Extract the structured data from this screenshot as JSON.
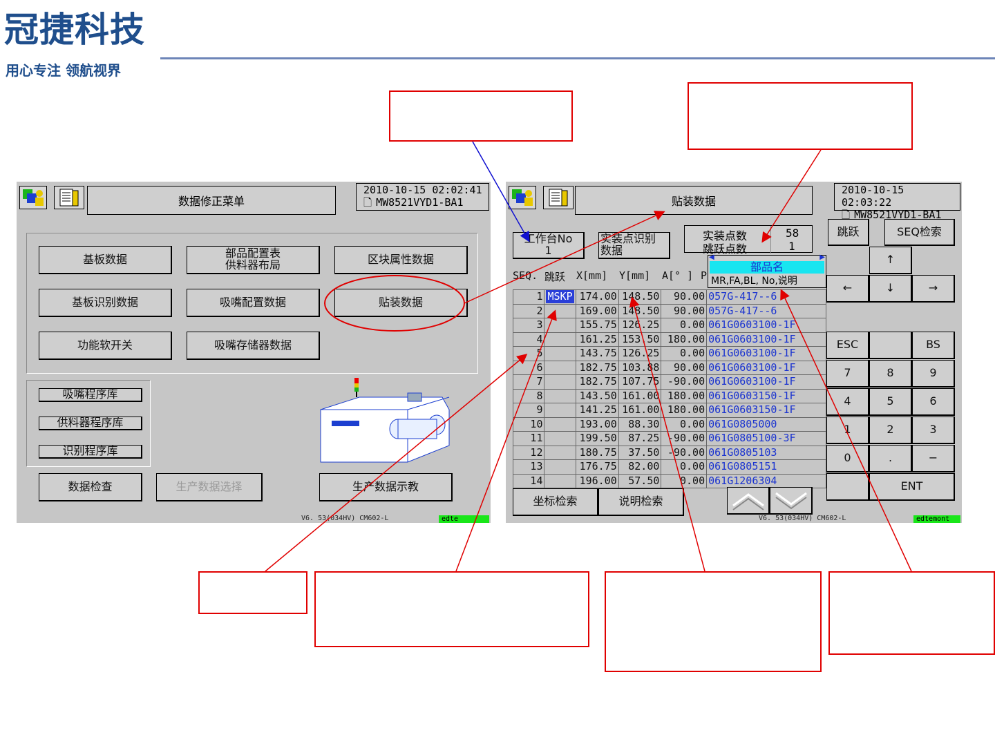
{
  "logo": {
    "main": "冠捷科技",
    "sub": "用心专注 领航视界"
  },
  "left_screen": {
    "title": "数据修正菜单",
    "datetime": "2010-10-15  02:02:41",
    "program": "MW8521VYD1-BA1",
    "menu": [
      {
        "label": "基板数据"
      },
      {
        "label": "部品配置表\n供料器布局"
      },
      {
        "label": "区块属性数据"
      },
      {
        "label": "基板识别数据"
      },
      {
        "label": "吸嘴配置数据"
      },
      {
        "label": "贴装数据"
      },
      {
        "label": "功能软开关"
      },
      {
        "label": "吸嘴存储器数据"
      }
    ],
    "libraries": [
      "吸嘴程序库",
      "供料器程序库",
      "识别程序库"
    ],
    "bottom": {
      "check": "数据检查",
      "select": "生产数据选择",
      "teach": "生产数据示教"
    },
    "version": "V6. 53(034HV)   CM602-L",
    "status": "edte"
  },
  "right_screen": {
    "title": "贴装数据",
    "datetime": "2010-10-15  02:03:22",
    "program": "MW8521VYD1-BA1",
    "table_no_label": "工作台No",
    "table_no_value": "1",
    "recog_label": "实装点识别\n数据",
    "count_mount_label": "实装点数",
    "count_mount_value": "58",
    "count_skip_label": "跳跃点数",
    "count_skip_value": "1",
    "jump_button": "跳跃",
    "seq_search_button": "SEQ检索",
    "columns": [
      "SEQ.",
      "跳跃",
      "X[mm]",
      "Y[mm]",
      "A[° ]",
      "P"
    ],
    "part_header": "部品名",
    "part_subheader": "MR,FA,BL,   No,说明",
    "rows": [
      {
        "seq": "1",
        "skip": "MSKP",
        "x": "174.00",
        "y": "148.50",
        "a": "90.00",
        "part": "057G-417--6"
      },
      {
        "seq": "2",
        "skip": "",
        "x": "169.00",
        "y": "148.50",
        "a": "90.00",
        "part": "057G-417--6"
      },
      {
        "seq": "3",
        "skip": "",
        "x": "155.75",
        "y": "126.25",
        "a": "0.00",
        "part": "061G0603100-1F"
      },
      {
        "seq": "4",
        "skip": "",
        "x": "161.25",
        "y": "153.50",
        "a": "180.00",
        "part": "061G0603100-1F"
      },
      {
        "seq": "5",
        "skip": "",
        "x": "143.75",
        "y": "126.25",
        "a": "0.00",
        "part": "061G0603100-1F"
      },
      {
        "seq": "6",
        "skip": "",
        "x": "182.75",
        "y": "103.88",
        "a": "90.00",
        "part": "061G0603100-1F"
      },
      {
        "seq": "7",
        "skip": "",
        "x": "182.75",
        "y": "107.75",
        "a": "-90.00",
        "part": "061G0603100-1F"
      },
      {
        "seq": "8",
        "skip": "",
        "x": "143.50",
        "y": "161.00",
        "a": "180.00",
        "part": "061G0603150-1F"
      },
      {
        "seq": "9",
        "skip": "",
        "x": "141.25",
        "y": "161.00",
        "a": "180.00",
        "part": "061G0603150-1F"
      },
      {
        "seq": "10",
        "skip": "",
        "x": "193.00",
        "y": "88.30",
        "a": "0.00",
        "part": "061G0805000"
      },
      {
        "seq": "11",
        "skip": "",
        "x": "199.50",
        "y": "87.25",
        "a": "-90.00",
        "part": "061G0805100-3F"
      },
      {
        "seq": "12",
        "skip": "",
        "x": "180.75",
        "y": "37.50",
        "a": "-90.00",
        "part": "061G0805103"
      },
      {
        "seq": "13",
        "skip": "",
        "x": "176.75",
        "y": "82.00",
        "a": "0.00",
        "part": "061G0805151"
      },
      {
        "seq": "14",
        "skip": "",
        "x": "196.00",
        "y": "57.50",
        "a": "0.00",
        "part": "061G1206304"
      }
    ],
    "coord_search": "坐标检索",
    "desc_search": "说明检索",
    "arrows": {
      "up": "↑",
      "left": "←",
      "down": "↓",
      "right": "→"
    },
    "keys": {
      "esc": "ESC",
      "bs": "BS",
      "k7": "7",
      "k8": "8",
      "k9": "9",
      "k4": "4",
      "k5": "5",
      "k6": "6",
      "k1": "1",
      "k2": "2",
      "k3": "3",
      "k0": "0",
      "dot": ".",
      "minus": "−",
      "ent": "ENT"
    },
    "version": "V6. 53(034HV)   CM602-L",
    "status": "edtemont"
  },
  "colors": {
    "line_red": "#e00000",
    "line_blue": "#1010d0",
    "brand": "#1f4e8c",
    "panel": "#c6c6c6"
  }
}
